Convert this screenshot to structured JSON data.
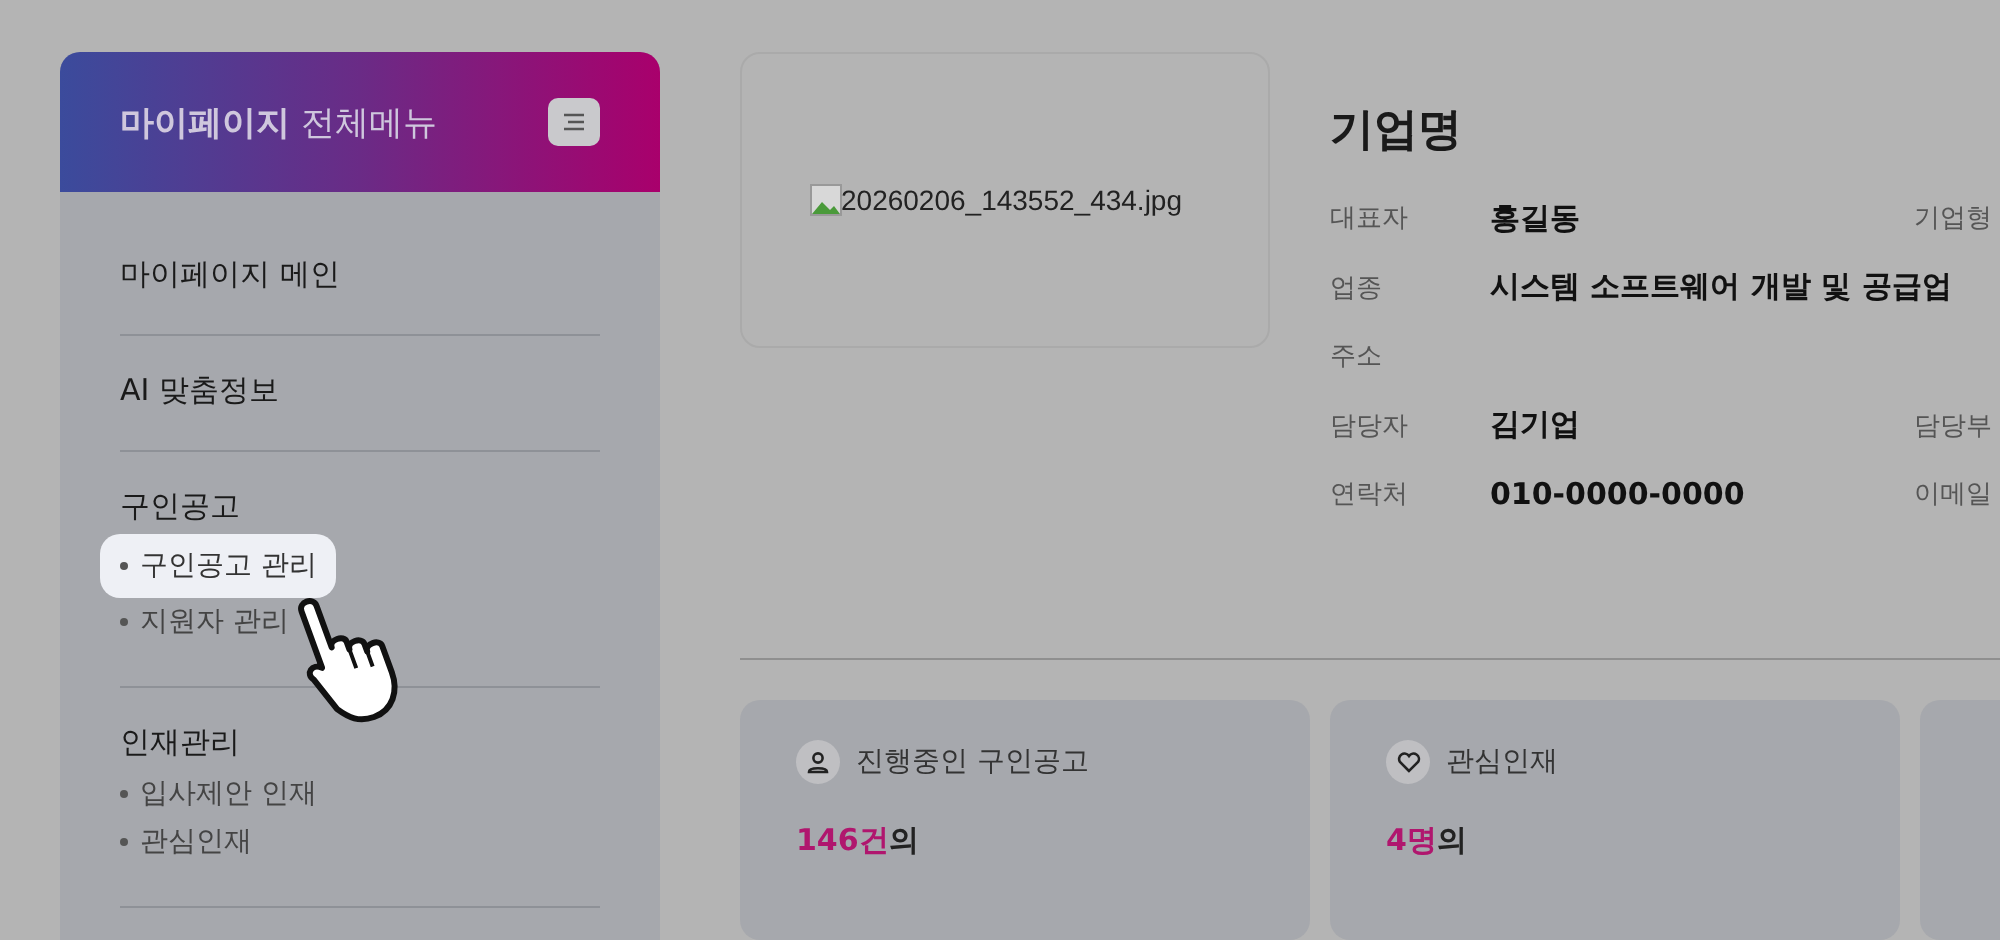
{
  "sidebar": {
    "title": "마이페이지",
    "subtitle": "전체메뉴",
    "sections": [
      {
        "label": "마이페이지 메인"
      },
      {
        "label": "AI 맞춤정보"
      },
      {
        "label": "구인공고",
        "items": [
          {
            "label": "구인공고 관리",
            "selected": true
          },
          {
            "label": "지원자 관리",
            "selected": false
          }
        ]
      },
      {
        "label": "인재관리",
        "items": [
          {
            "label": "입사제안 인재",
            "selected": false
          },
          {
            "label": "관심인재",
            "selected": false
          }
        ]
      }
    ]
  },
  "company": {
    "image_alt": "20260206_143552_434.jpg",
    "name": "기업명",
    "rows": [
      {
        "label": "대표자",
        "value": "홍길동",
        "extra_label": "기업형"
      },
      {
        "label": "업종",
        "value": "시스템 소프트웨어 개발 및 공급업"
      },
      {
        "label": "주소"
      },
      {
        "label": "담당자",
        "value": "김기업",
        "extra_label": "담당부"
      },
      {
        "label": "연락처",
        "value": "010-0000-0000",
        "extra_label": "이메일"
      }
    ]
  },
  "stats": [
    {
      "kind": "person",
      "title": "진행중인 구인공고",
      "count": "146건",
      "suffix": "의"
    },
    {
      "kind": "heart",
      "title": "관심인재",
      "count": "4명",
      "suffix": "의"
    }
  ]
}
